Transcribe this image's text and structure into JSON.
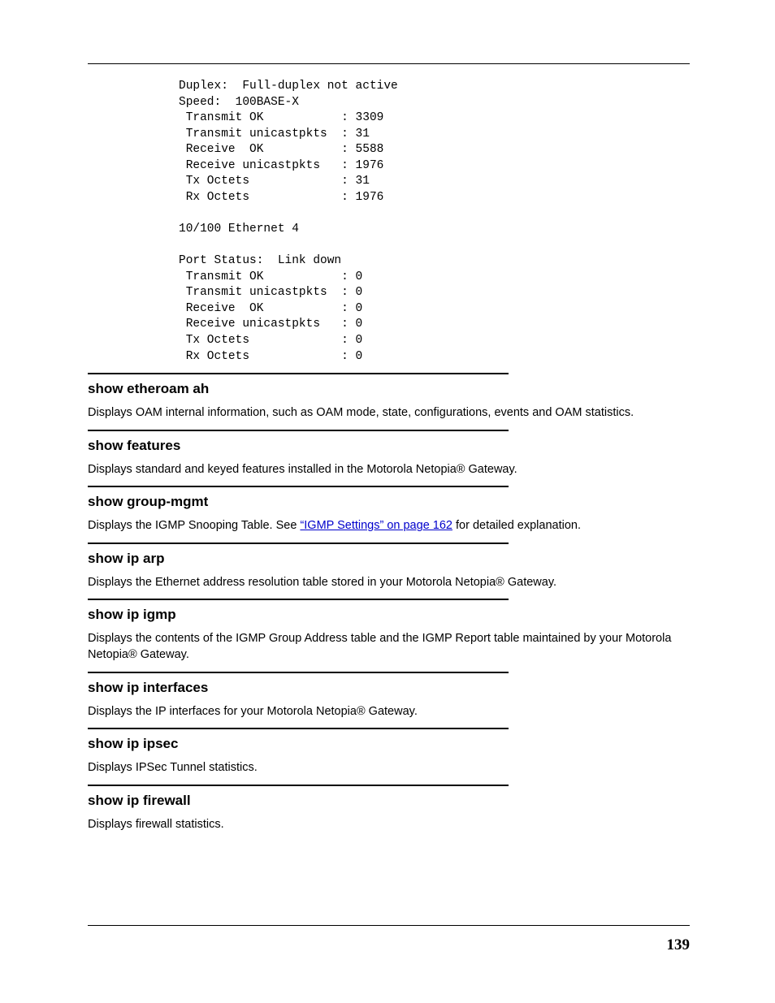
{
  "pre_lines": [
    "Duplex:  Full-duplex not active",
    "Speed:  100BASE-X",
    " Transmit OK           : 3309",
    " Transmit unicastpkts  : 31",
    " Receive  OK           : 5588",
    " Receive unicastpkts   : 1976",
    " Tx Octets             : 31",
    " Rx Octets             : 1976",
    "",
    "10/100 Ethernet 4",
    "",
    "Port Status:  Link down",
    " Transmit OK           : 0",
    " Transmit unicastpkts  : 0",
    " Receive  OK           : 0",
    " Receive unicastpkts   : 0",
    " Tx Octets             : 0",
    " Rx Octets             : 0"
  ],
  "sections": [
    {
      "heading": "show etheroam ah",
      "desc": "Displays OAM internal information, such as OAM mode, state, configurations, events and OAM statistics."
    },
    {
      "heading": "show features",
      "desc": "Displays standard and keyed features installed in the Motorola Netopia® Gateway."
    },
    {
      "heading": "show group-mgmt",
      "desc_before": "Displays the IGMP Snooping Table. See ",
      "link_text": "“IGMP Settings” on page 162",
      "desc_after": " for detailed explanation."
    },
    {
      "heading": "show ip arp",
      "desc": "Displays the Ethernet address resolution table stored in your Motorola Netopia® Gateway."
    },
    {
      "heading": "show ip igmp",
      "desc": "Displays the contents of the IGMP Group Address table and the IGMP Report table maintained by your Motorola Netopia® Gateway."
    },
    {
      "heading": "show ip interfaces",
      "desc": "Displays the IP interfaces for your Motorola Netopia® Gateway."
    },
    {
      "heading": "show ip ipsec",
      "desc": "Displays IPSec Tunnel statistics."
    },
    {
      "heading": "show ip firewall",
      "desc": "Displays firewall statistics."
    }
  ],
  "page_number": "139"
}
